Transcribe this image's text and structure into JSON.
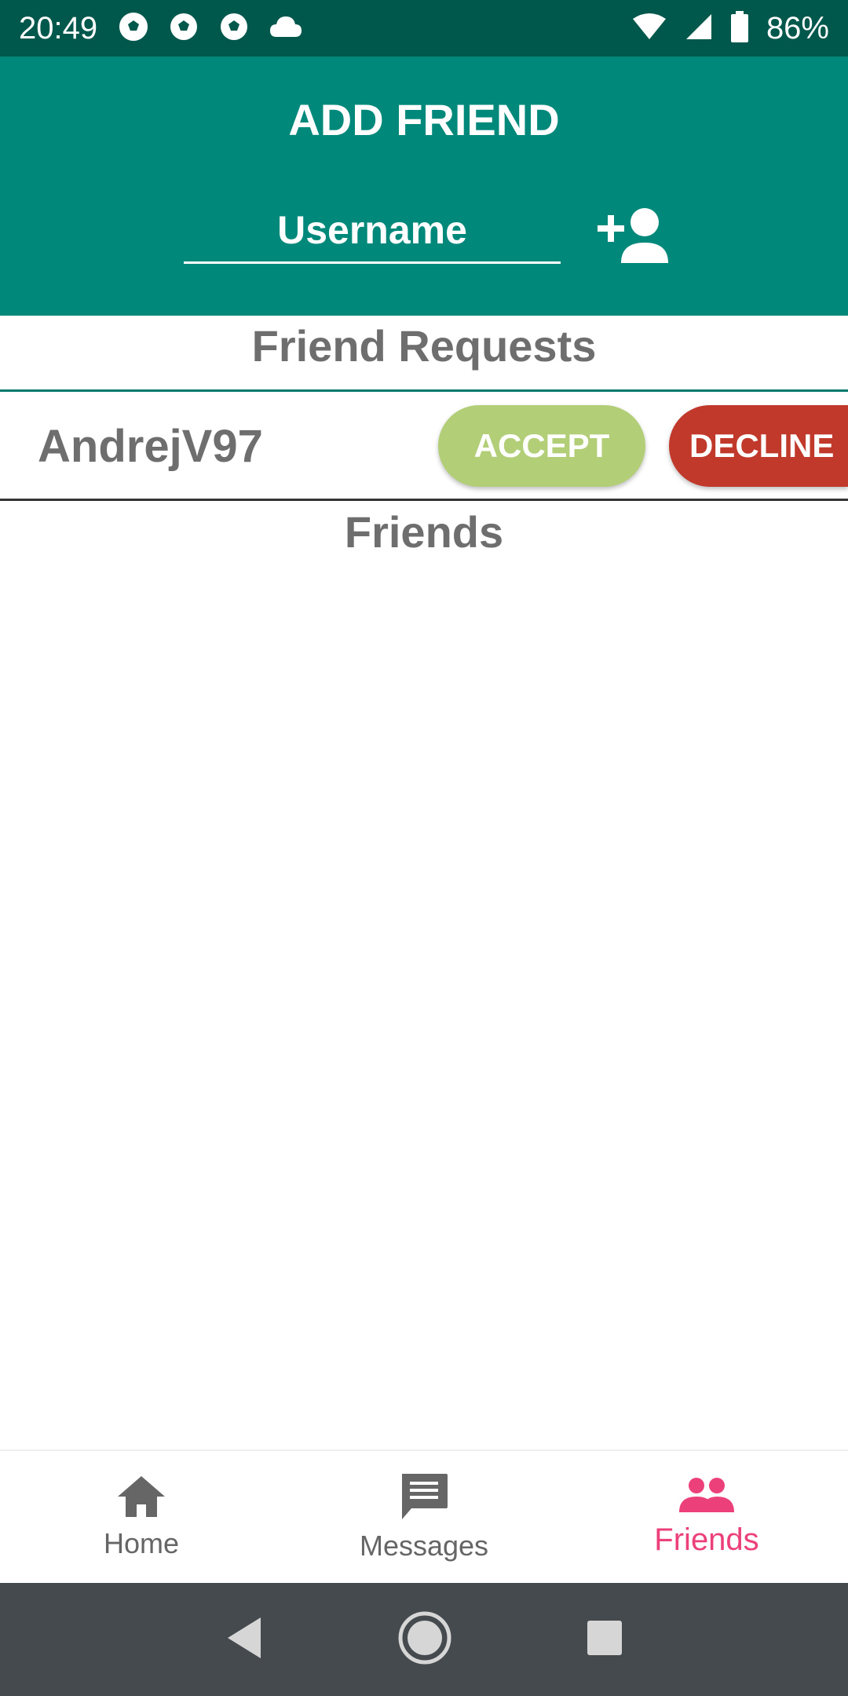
{
  "status_bar": {
    "time": "20:49",
    "notification_icons": [
      "soccer-ball-icon",
      "soccer-ball-icon",
      "soccer-ball-icon",
      "cloud-icon"
    ],
    "battery": "86%"
  },
  "header": {
    "title": "ADD FRIEND",
    "username_placeholder": "Username",
    "add_icon": "person-add-icon",
    "background_color": "#00897b"
  },
  "requests": {
    "title": "Friend Requests",
    "items": [
      {
        "username": "AndrejV97",
        "accept_label": "ACCEPT",
        "decline_label": "DECLINE"
      }
    ],
    "accept_color": "#b2cf78",
    "decline_color": "#c0392b"
  },
  "friends": {
    "title": "Friends",
    "items": []
  },
  "bottom_nav": {
    "items": [
      {
        "label": "Home",
        "icon": "home-icon"
      },
      {
        "label": "Messages",
        "icon": "message-icon"
      },
      {
        "label": "Friends",
        "icon": "people-icon"
      }
    ],
    "active": "Friends",
    "active_color": "#ec407a"
  },
  "system_nav": {
    "buttons": [
      "back-icon",
      "home-circle-icon",
      "recents-icon"
    ]
  }
}
